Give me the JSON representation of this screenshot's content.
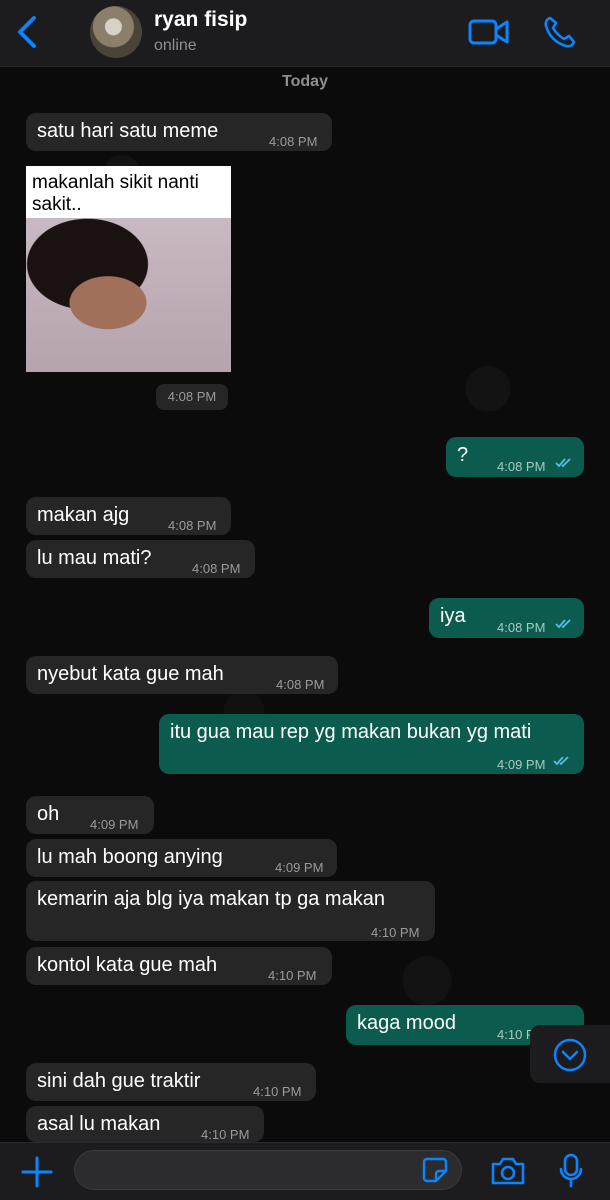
{
  "header": {
    "contact_name": "ryan fisip",
    "status": "online"
  },
  "date_separator": "Today",
  "meme": {
    "caption": "makanlah sikit nanti sakit..",
    "time": "4:08 PM"
  },
  "messages": [
    {
      "dir": "in",
      "text": "satu hari satu meme",
      "time": "4:08 PM"
    },
    {
      "dir": "out",
      "text": "?",
      "time": "4:08 PM"
    },
    {
      "dir": "in",
      "text": "makan ajg",
      "time": "4:08 PM"
    },
    {
      "dir": "in",
      "text": "lu mau mati?",
      "time": "4:08 PM"
    },
    {
      "dir": "out",
      "text": "iya",
      "time": "4:08 PM"
    },
    {
      "dir": "in",
      "text": "nyebut kata gue mah",
      "time": "4:08 PM"
    },
    {
      "dir": "out",
      "text": "itu gua mau rep yg makan bukan yg mati",
      "time": "4:09 PM"
    },
    {
      "dir": "in",
      "text": "oh",
      "time": "4:09 PM"
    },
    {
      "dir": "in",
      "text": "lu mah boong anying",
      "time": "4:09 PM"
    },
    {
      "dir": "in",
      "text": "kemarin aja blg iya makan tp ga makan",
      "time": "4:10 PM"
    },
    {
      "dir": "in",
      "text": "kontol kata gue mah",
      "time": "4:10 PM"
    },
    {
      "dir": "out",
      "text": "kaga mood",
      "time": "4:10 PM"
    },
    {
      "dir": "in",
      "text": "sini dah gue traktir",
      "time": "4:10 PM"
    },
    {
      "dir": "in",
      "text": "asal lu makan",
      "time": "4:10 PM"
    }
  ],
  "colors": {
    "accent": "#0a84ff",
    "incoming_bubble": "#262626",
    "outgoing_bubble": "#0b5c4e",
    "read_tick": "#53bdeb"
  }
}
